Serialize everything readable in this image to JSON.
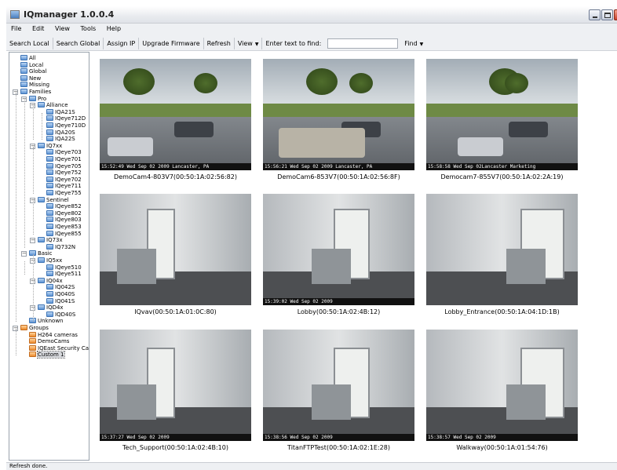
{
  "window": {
    "title": "IQmanager  1.0.0.4"
  },
  "menu": [
    "File",
    "Edit",
    "View",
    "Tools",
    "Help"
  ],
  "toolbar": {
    "search_local": "Search Local",
    "search_global": "Search Global",
    "assign_ip": "Assign IP",
    "upgrade_firmware": "Upgrade Firmware",
    "refresh": "Refresh",
    "view": "View",
    "find_prompt": "Enter text to find:",
    "find_value": "",
    "find": "Find"
  },
  "tree": [
    "All",
    "Local",
    "Global",
    "New",
    "Missing",
    "Families",
    "Pro",
    "Alliance",
    "IQA21S",
    "IQeye712D",
    "IQeye710D",
    "IQA20S",
    "IQA22S",
    "IQ7xx",
    "IQeye703",
    "IQeye701",
    "IQeye705",
    "IQeye752",
    "IQeye702",
    "IQeye711",
    "IQeye755",
    "Sentinel",
    "IQeye852",
    "IQeye802",
    "IQeye803",
    "IQeye853",
    "IQeye855",
    "IQ73x",
    "IQ732N",
    "Basic",
    "IQ5xx",
    "IQeye510",
    "IQeye511",
    "IQ04x",
    "IQ042S",
    "IQ040S",
    "IQ041S",
    "IQD4x",
    "IQD40S",
    "Unknown",
    "Groups",
    "H264 cameras",
    "DemoCams",
    "IQEast Security Cams",
    "Custom 1"
  ],
  "cameras": [
    {
      "caption": "DemoCam4-803V7(00:50:1A:02:56:82)",
      "stamp": "15:52:49 Wed Sep 02 2009 Lancaster, PA"
    },
    {
      "caption": "DemoCam6-853V7(00:50:1A:02:56:8F)",
      "stamp": "15:56:21 Wed Sep 02 2009 Lancaster, PA"
    },
    {
      "caption": "Democam7-855V7(00:50:1A:02:2A:19)",
      "stamp": "15:58:58 Wed Sep 02Lancaster Marketing"
    },
    {
      "caption": "IQvav(00:50:1A:01:0C:80)",
      "stamp": ""
    },
    {
      "caption": "Lobby(00:50:1A:02:4B:12)",
      "stamp": "15:39:02 Wed Sep 02 2009"
    },
    {
      "caption": "Lobby_Entrance(00:50:1A:04:1D:1B)",
      "stamp": ""
    },
    {
      "caption": "Tech_Support(00:50:1A:02:4B:10)",
      "stamp": "15:37:27 Wed Sep 02 2009"
    },
    {
      "caption": "TitanFTPTest(00:50:1A:02:1E:28)",
      "stamp": "15:38:56 Wed Sep 02 2009"
    },
    {
      "caption": "Walkway(00:50:1A:01:54:76)",
      "stamp": "15:38:57 Wed Sep 02 2009"
    }
  ],
  "status": "Refresh done."
}
